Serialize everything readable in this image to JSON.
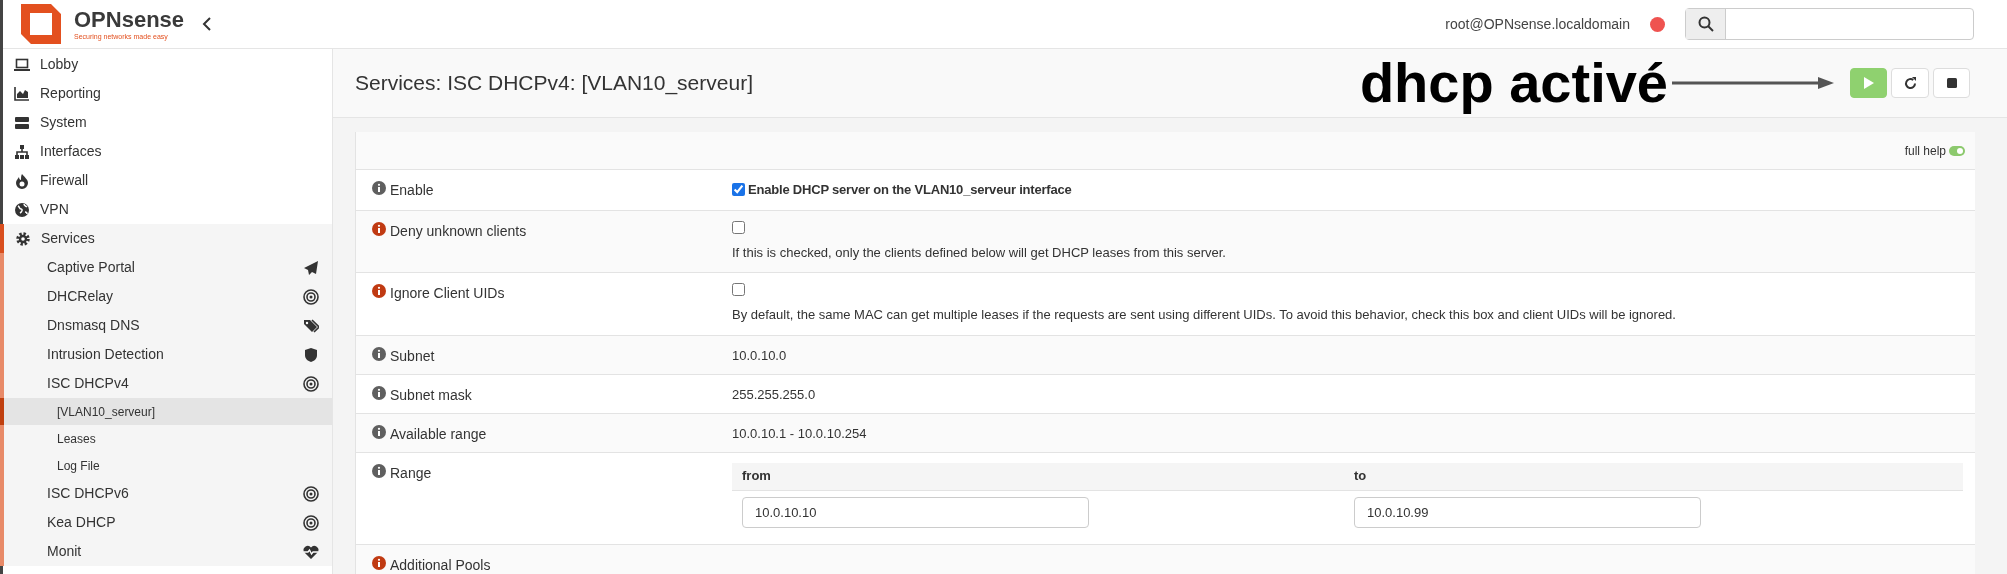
{
  "brand": {
    "name": "OPNsense",
    "tagline": "Securing networks made easy"
  },
  "user": "root@OPNsense.localdomain",
  "sidebar": {
    "items": [
      {
        "label": "Lobby",
        "selected": false
      },
      {
        "label": "Reporting",
        "selected": false
      },
      {
        "label": "System",
        "selected": false
      },
      {
        "label": "Interfaces",
        "selected": false
      },
      {
        "label": "Firewall",
        "selected": false
      },
      {
        "label": "VPN",
        "selected": false
      },
      {
        "label": "Services",
        "selected": false,
        "expanded": true,
        "children": [
          {
            "label": "Captive Portal",
            "selected": false
          },
          {
            "label": "DHCRelay",
            "selected": false
          },
          {
            "label": "Dnsmasq DNS",
            "selected": false
          },
          {
            "label": "Intrusion Detection",
            "selected": false
          },
          {
            "label": "ISC DHCPv4",
            "selected": false,
            "expanded": true,
            "children": [
              {
                "label": "[VLAN10_serveur]",
                "selected": true
              },
              {
                "label": "Leases",
                "selected": false
              },
              {
                "label": "Log File",
                "selected": false
              }
            ]
          },
          {
            "label": "ISC DHCPv6",
            "selected": false
          },
          {
            "label": "Kea DHCP",
            "selected": false
          },
          {
            "label": "Monit",
            "selected": false
          }
        ]
      }
    ]
  },
  "page_title": "Services: ISC DHCPv4: [VLAN10_serveur]",
  "annotation": {
    "text": "dhcp activé"
  },
  "service": {
    "running": true
  },
  "full_help": {
    "label": "full help",
    "on": true
  },
  "rows": [
    {
      "kind": "checkbox",
      "label": "Enable",
      "color": "#5f5f5f",
      "checked": true,
      "checkbox_label": "Enable DHCP server on the VLAN10_serveur interface"
    },
    {
      "kind": "checkbox",
      "label": "Deny unknown clients",
      "color": "#c03a12",
      "checked": false,
      "help": "If this is checked, only the clients defined below will get DHCP leases from this server."
    },
    {
      "kind": "checkbox",
      "label": "Ignore Client UIDs",
      "color": "#c03a12",
      "checked": false,
      "help": "By default, the same MAC can get multiple leases if the requests are sent using different UIDs. To avoid this behavior, check this box and client UIDs will be ignored."
    },
    {
      "kind": "text",
      "label": "Subnet",
      "color": "#5f5f5f",
      "value": "10.0.10.0"
    },
    {
      "kind": "text",
      "label": "Subnet mask",
      "color": "#5f5f5f",
      "value": "255.255.255.0"
    },
    {
      "kind": "text",
      "label": "Available range",
      "color": "#5f5f5f",
      "value": "10.0.10.1 - 10.0.10.254"
    },
    {
      "kind": "range",
      "label": "Range",
      "color": "#5f5f5f",
      "from_label": "from",
      "to_label": "to",
      "from": "10.0.10.10",
      "to": "10.0.10.99"
    },
    {
      "kind": "text",
      "label": "Additional Pools",
      "color": "#c03a12"
    }
  ]
}
